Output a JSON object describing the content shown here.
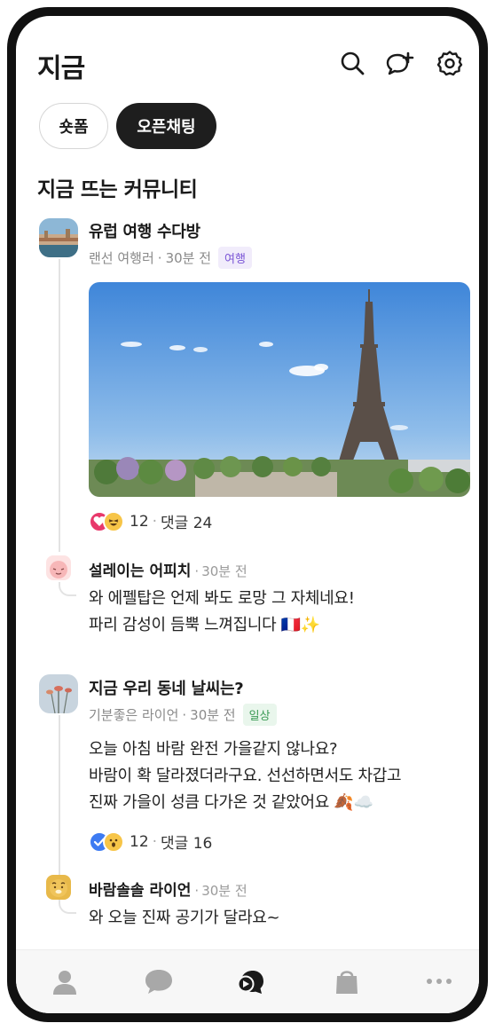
{
  "header": {
    "title": "지금",
    "icons": [
      "search-icon",
      "chat-add-icon",
      "gear-icon"
    ]
  },
  "tabs": [
    {
      "label": "숏폼",
      "selected": false
    },
    {
      "label": "오픈채팅",
      "selected": true
    }
  ],
  "section": {
    "title": "지금 뜨는 커뮤니티"
  },
  "posts": [
    {
      "title": "유럽 여행 수다방",
      "author": "랜선 여행러",
      "time": "30분 전",
      "tag": "여행",
      "reaction_count": "12",
      "comments": "댓글 24",
      "reaction_icons": [
        "heart-reaction-icon",
        "laughing-emoji-icon"
      ],
      "reply": {
        "name": "설레이는 어피치",
        "time": "30분 전",
        "line1": "와 에펠탑은 언제 봐도 로망 그 자체네요!",
        "line2": "파리 감성이 듬뿍 느껴집니다 🇫🇷✨"
      }
    },
    {
      "title": "지금 우리 동네 날씨는?",
      "author": "기분좋은 라이언",
      "time": "30분 전",
      "tag": "일상",
      "line1": "오늘 아침 바람 완전 가을같지 않나요?",
      "line2": "바람이 확 달라졌더라구요. 선선하면서도 차갑고",
      "line3": "진짜 가을이 성큼 다가온 것 같았어요 🍂☁️",
      "reaction_count": "12",
      "comments": "댓글 16",
      "reaction_icons": [
        "check-reaction-icon",
        "surprised-emoji-icon"
      ],
      "reply": {
        "name": "바람솔솔 라이언",
        "time": "30분 전",
        "line1": "와 오늘 진짜 공기가 달라요~"
      }
    }
  ],
  "separators": {
    "dot": "·"
  },
  "bottom_nav": [
    "friends-icon",
    "chats-icon",
    "now-icon",
    "shopping-icon",
    "more-icon"
  ],
  "colors": {
    "accent_dark": "#1e1e1e",
    "tag_purple": "#7a55d6",
    "tag_green": "#3a9a55",
    "heart": "#e8386b",
    "check": "#3d7bf2"
  }
}
